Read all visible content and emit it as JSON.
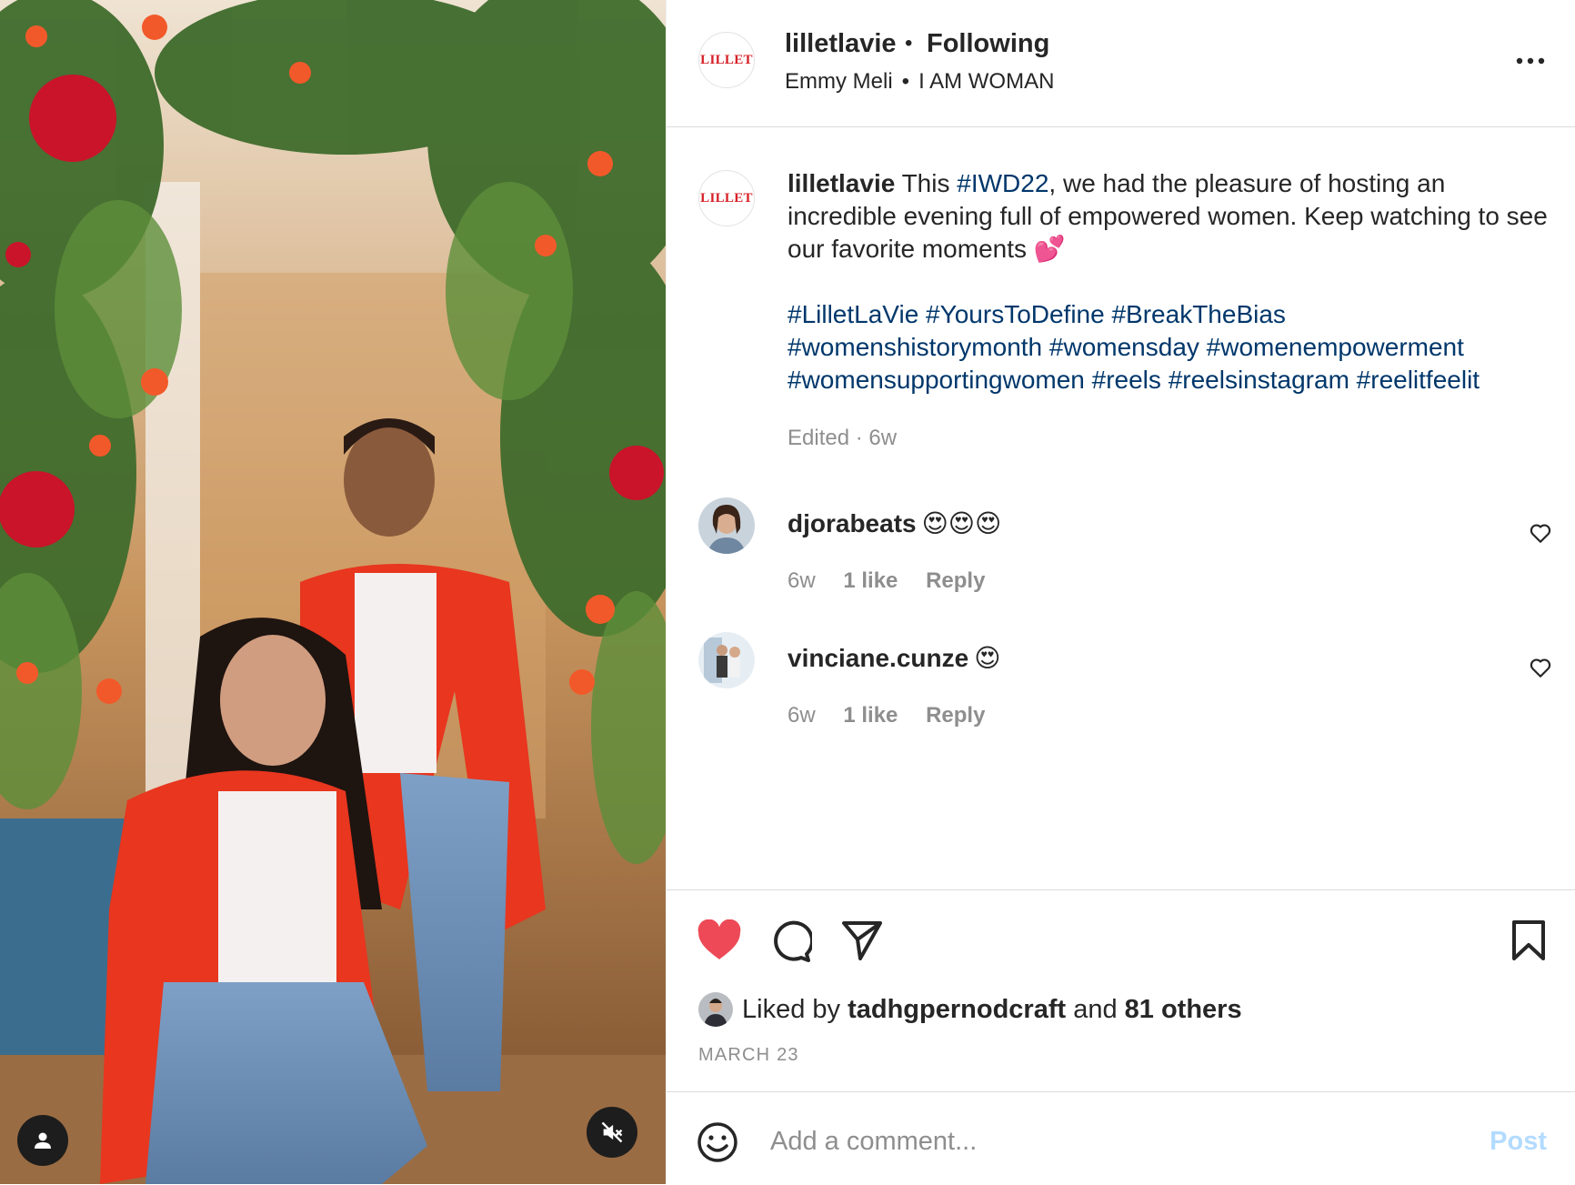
{
  "post": {
    "username": "lilletlavie",
    "dot": "•",
    "follow_status": "Following",
    "sub_primary": "Emmy Meli",
    "sub_secondary": "I AM WOMAN",
    "avatar_text": "LILLET"
  },
  "caption": {
    "username": "lilletlavie",
    "text_1": "This ",
    "tag_1": "#IWD22",
    "text_2": ", we had the pleasure of hosting an incredible evening full of empowered women. Keep watching to see our favorite moments 💕",
    "hashtags": [
      "#LilletLaVie",
      "#YoursToDefine",
      "#BreakTheBias",
      "#womenshistorymonth",
      "#womensday",
      "#womenempowerment",
      "#womensupportingwomen",
      "#reels",
      "#reelsinstagram",
      "#reelitfeelit"
    ],
    "edited": "Edited · 6w"
  },
  "comments": [
    {
      "username": "djorabeats",
      "text": "😍😍😍",
      "time": "6w",
      "likes": "1 like",
      "reply": "Reply"
    },
    {
      "username": "vinciane.cunze",
      "text": "😍",
      "time": "6w",
      "likes": "1 like",
      "reply": "Reply"
    }
  ],
  "engagement": {
    "liked_prefix": "Liked by",
    "liked_user": "tadhgpernodcraft",
    "liked_and": "and",
    "liked_others": "81 others",
    "date": "MARCH 23"
  },
  "composer": {
    "placeholder": "Add a comment...",
    "post_label": "Post"
  },
  "icons": {
    "like": "heart-filled-icon",
    "comment": "comment-icon",
    "share": "paper-plane-icon",
    "save": "bookmark-icon",
    "more": "ellipsis-icon",
    "emoji": "smiley-icon",
    "tag": "person-icon",
    "mute": "speaker-muted-icon"
  },
  "colors": {
    "like_red": "#ed4956",
    "hashtag_blue": "#00376b",
    "muted_gray": "#8e8e8e",
    "post_disabled": "#b3dbff",
    "brand_red": "#d62027"
  }
}
